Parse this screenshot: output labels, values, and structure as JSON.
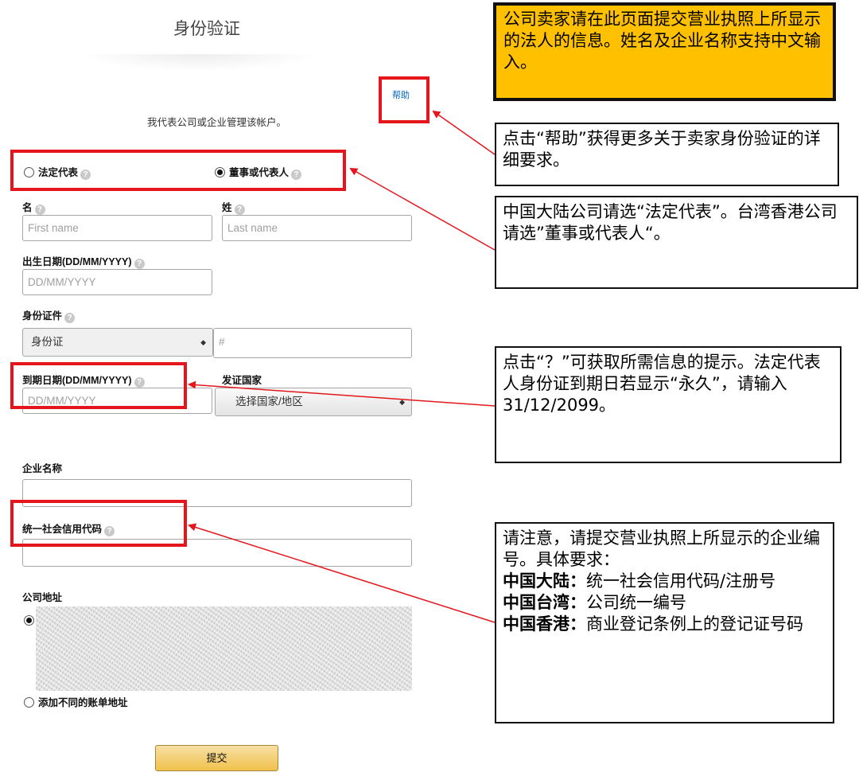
{
  "form": {
    "title": "身份验证",
    "help_link": "帮助",
    "manage_text": "我代表公司或企业管理该帐户。",
    "radio_legal_rep": "法定代表",
    "radio_director": "董事或代表人",
    "first_name_label": "名",
    "first_name_placeholder": "First name",
    "last_name_label": "姓",
    "last_name_placeholder": "Last name",
    "dob_label": "出生日期(DD/MM/YYYY)",
    "dob_placeholder": "DD/MM/YYYY",
    "id_doc_label": "身份证件",
    "id_doc_selected": "身份证",
    "id_number_placeholder": "#",
    "expiry_label": "到期日期(DD/MM/YYYY)",
    "expiry_placeholder": "DD/MM/YYYY",
    "issuing_country_label": "发证国家",
    "issuing_country_selected": "选择国家/地区",
    "company_name_label": "企业名称",
    "credit_code_label": "统一社会信用代码",
    "company_address_label": "公司地址",
    "add_billing_address": "添加不同的账单地址",
    "submit_label": "提交",
    "question_glyph": "?"
  },
  "annotations": {
    "top_yellow": "公司卖家请在此页面提交营业执照上所显示的法人的信息。姓名及企业名称支持中文输入。",
    "help_note": "点击“帮助”获得更多关于卖家身份验证的详细要求。",
    "radio_note": "中国大陆公司请选“法定代表”。台湾香港公司请选”董事或代表人“。",
    "question_note": "点击“？”可获取所需信息的提示。法定代表人身份证到期日若显示“永久”，请输入31/12/2099。",
    "company_id_note_intro": "请注意，请提交营业执照上所显示的企业编号。具体要求：",
    "mainland_label": "中国大陆：",
    "mainland_text": "统一社会信用代码/注册号",
    "taiwan_label": "中国台湾：",
    "taiwan_text": "公司统一编号",
    "hongkong_label": "中国香港：",
    "hongkong_text": "商业登记条例上的登记证号码"
  },
  "colors": {
    "highlight_red": "#e4161b",
    "annotation_yellow": "#ffc000",
    "link_blue": "#0066c0",
    "button_gold": "#f0c14b"
  },
  "icons": [
    "help-question-icon",
    "radio-icon",
    "dropdown-arrow-icon"
  ]
}
